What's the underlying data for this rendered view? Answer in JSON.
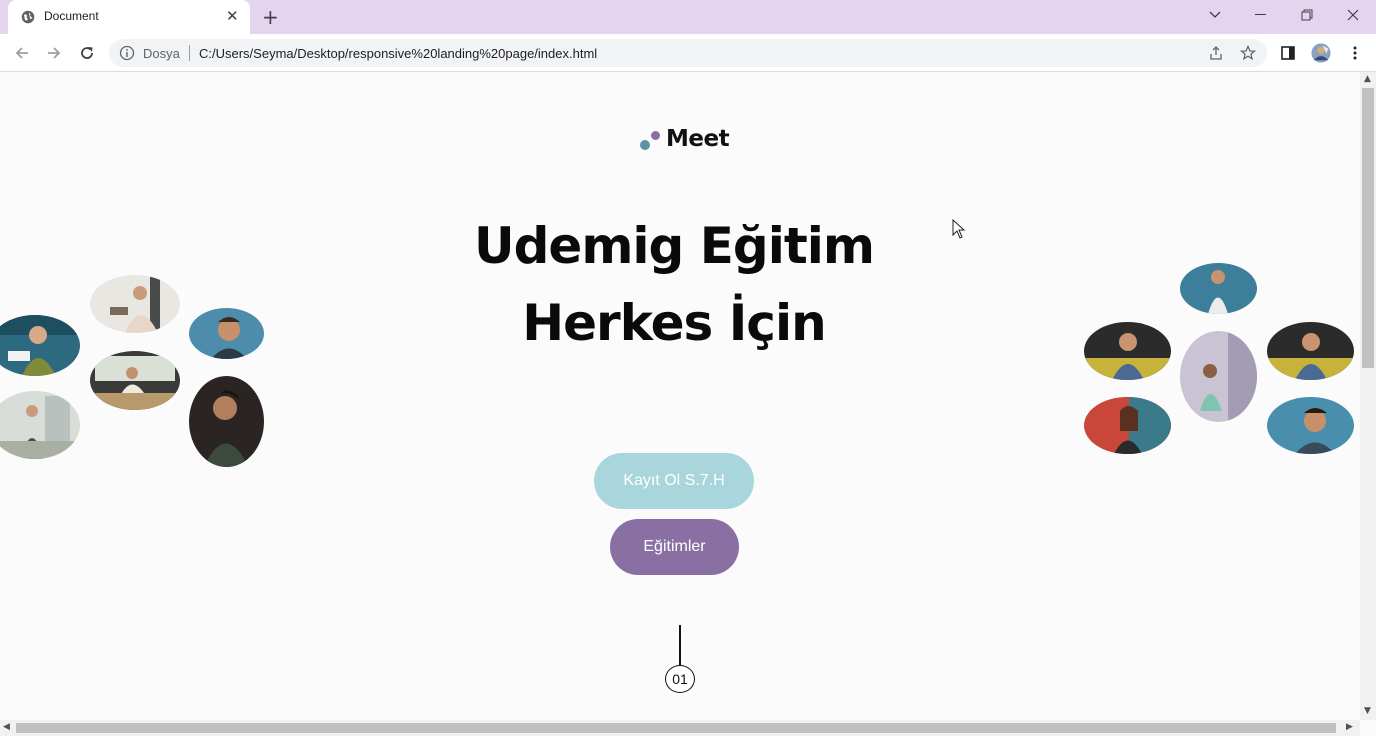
{
  "browser": {
    "tab_title": "Document",
    "address_prefix": "Dosya",
    "url": "C:/Users/Seyma/Desktop/responsive%20landing%20page/index.html"
  },
  "page": {
    "logo_text": "Meet",
    "headline_line1": "Udemig Eğitim",
    "headline_line2": "Herkes İçin",
    "register_button": "Kayıt Ol S.7.H",
    "courses_button": "Eğitimler",
    "page_number": "01"
  },
  "colors": {
    "accent_teal": "#a9d6dc",
    "accent_purple": "#8a6fa3",
    "logo_dot_teal": "#5a93a8"
  },
  "icons": [
    "globe-icon",
    "close-icon",
    "plus-icon",
    "back-icon",
    "forward-icon",
    "reload-icon",
    "info-icon",
    "share-icon",
    "star-icon",
    "side-panel-icon",
    "profile-avatar",
    "menu-icon"
  ]
}
